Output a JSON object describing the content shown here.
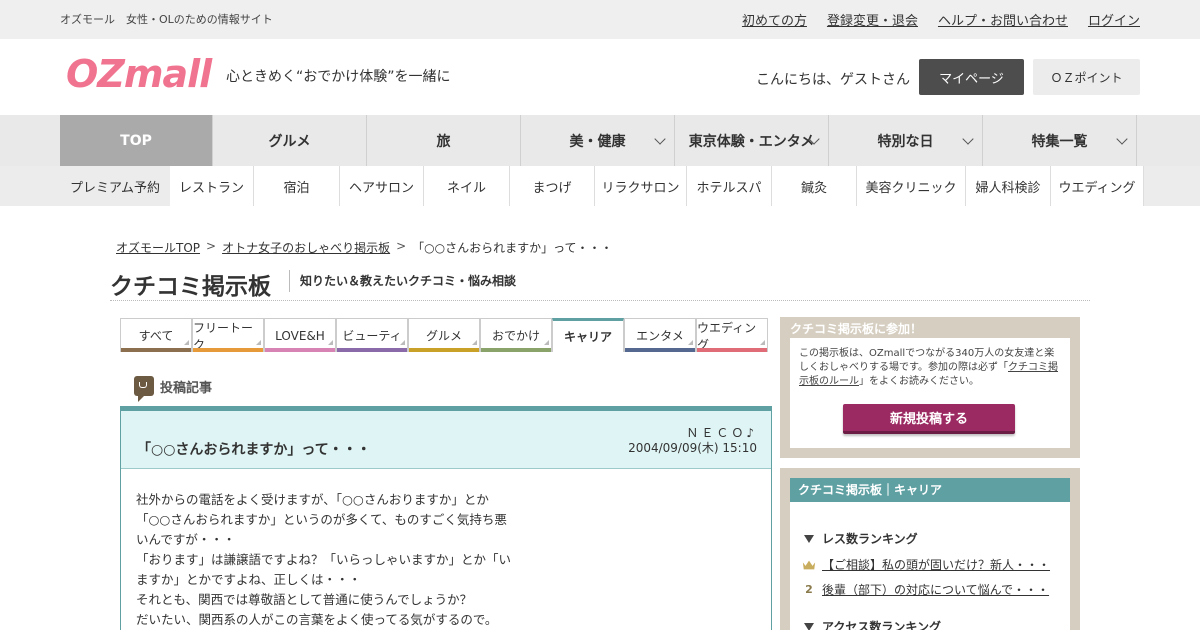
{
  "topbar": {
    "tagline": "オズモール　女性・OLのための情報サイト",
    "links": [
      "初めての方",
      "登録変更・退会",
      "ヘルプ・お問い合わせ",
      "ログイン"
    ]
  },
  "header": {
    "logo": "OZmall",
    "catch": "心ときめく“おでかけ体験”を一緒に",
    "greeting": "こんにちは、ゲストさん",
    "mypage": "マイページ",
    "point": "ＯＺポイント"
  },
  "gnav": [
    {
      "label": "TOP",
      "active": true,
      "chevron": false
    },
    {
      "label": "グルメ",
      "active": false,
      "chevron": false
    },
    {
      "label": "旅",
      "active": false,
      "chevron": false
    },
    {
      "label": "美・健康",
      "active": false,
      "chevron": true
    },
    {
      "label": "東京体験・エンタメ",
      "active": false,
      "chevron": true
    },
    {
      "label": "特別な日",
      "active": false,
      "chevron": true
    },
    {
      "label": "特集一覧",
      "active": false,
      "chevron": true
    }
  ],
  "snav": {
    "label": "プレミアム予約",
    "items": [
      "レストラン",
      "宿泊",
      "ヘアサロン",
      "ネイル",
      "まつげ",
      "リラクサロン",
      "ホテルスパ",
      "鍼灸",
      "美容クリニック",
      "婦人科検診",
      "ウエディング"
    ]
  },
  "breadcrumb": {
    "items": [
      "オズモールTOP",
      "オトナ女子のおしゃべり掲示板",
      "「○○さんおられますか」って・・・"
    ],
    "separator": ">"
  },
  "page": {
    "title": "クチコミ掲示板",
    "subtitle": "知りたい＆教えたいクチコミ・悩み相談"
  },
  "tabs": [
    {
      "label": "すべて",
      "color": "#8b6f4e",
      "active": false
    },
    {
      "label": "フリートーク",
      "color": "#e69a3a",
      "active": false
    },
    {
      "label": "LOVE&H",
      "color": "#d783b3",
      "active": false
    },
    {
      "label": "ビューティ",
      "color": "#8a6aa8",
      "active": false
    },
    {
      "label": "グルメ",
      "color": "#c9a028",
      "active": false
    },
    {
      "label": "おでかけ",
      "color": "#8aa36a",
      "active": false
    },
    {
      "label": "キャリア",
      "color": "#5fa0a3",
      "active": true
    },
    {
      "label": "エンタメ",
      "color": "#55688f",
      "active": false
    },
    {
      "label": "ウエディング",
      "color": "#e06c78",
      "active": false
    }
  ],
  "post": {
    "section_label": "投稿記事",
    "title": "「○○さんおられますか」って・・・",
    "author": "ＮＥＣＯ♪",
    "date": "2004/09/09(木) 15:10",
    "body": [
      "社外からの電話をよく受けますが、「○○さんおりますか」とか",
      "「○○さんおられますか」というのが多くて、ものすごく気持ち悪",
      "いんですが・・・",
      "「おります」は謙譲語ですよね？「いらっしゃいますか」とか「い",
      "ますか」とかですよね、正しくは・・・",
      "それとも、関西では尊敬語として普通に使うんでしょうか？",
      "だいたい、関西系の人がこの言葉をよく使ってる気がするので。"
    ]
  },
  "side_join": {
    "title": "クチコミ掲示板に参加！",
    "desc_before": "この掲示板は、OZmallでつながる340万人の女友達と楽しくおしゃべりする場です。参加の際は必ず「",
    "desc_link": "クチコミ掲示板のルール",
    "desc_after": "」をよくお読みください。",
    "button": "新規投稿する"
  },
  "side_rank": {
    "title": "クチコミ掲示板｜キャリア",
    "res_heading": "レス数ランキング",
    "res_items": [
      {
        "rank": "1",
        "text": "【ご相談】私の頭が固いだけ？新人・・・"
      },
      {
        "rank": "2",
        "text": "後輩（部下）の対応について悩んで・・・"
      }
    ],
    "access_heading": "アクセス数ランキング"
  }
}
